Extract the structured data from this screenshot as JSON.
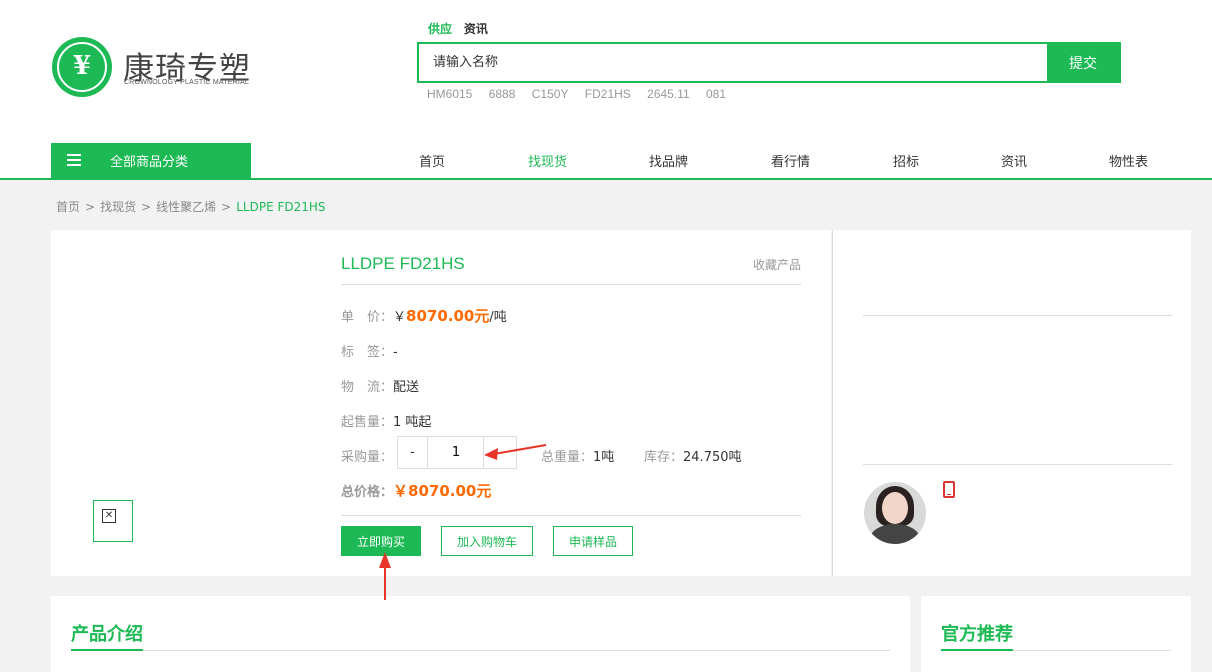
{
  "brand": {
    "name": "康琦专塑",
    "subtitle": "CROWNOLOGY PLASTIC MATERIAL"
  },
  "search": {
    "tabs": [
      "供应",
      "资讯"
    ],
    "placeholder": "请输入名称",
    "submit_label": "提交",
    "hot_keywords": [
      "HM6015",
      "6888",
      "C150Y",
      "FD21HS",
      "2645.11",
      "081"
    ]
  },
  "nav": {
    "category_label": "全部商品分类",
    "items": [
      "首页",
      "找现货",
      "找品牌",
      "看行情",
      "招标",
      "资讯",
      "物性表"
    ],
    "active": "找现货"
  },
  "breadcrumb": [
    "首页",
    "找现货",
    "线性聚乙烯",
    "LLDPE FD21HS"
  ],
  "product": {
    "title": "LLDPE FD21HS",
    "favorite_label": "收藏产品",
    "unit_price_label": "单　价：",
    "unit_price_symbol": "￥",
    "unit_price_value": "8070.00元",
    "unit_price_unit": "/吨",
    "tag_label": "标　签：",
    "tag_value": "-",
    "logistics_label": "物　流：",
    "logistics_value": "配送",
    "min_order_label": "起售量：",
    "min_order_value": "1 吨起",
    "quantity_label": "采购量：",
    "quantity_value": "1",
    "minus": "-",
    "total_weight_label": "总重量：",
    "total_weight_value": "1吨",
    "stock_label": "库存：",
    "stock_value": "24.750吨",
    "total_price_label": "总价格：",
    "total_price_value": "￥8070.00元",
    "buy_now_label": "立即购买",
    "add_cart_label": "加入购物车",
    "sample_label": "申请样品"
  },
  "sections": {
    "intro_title": "产品介绍",
    "recommend_title": "官方推荐"
  },
  "colors": {
    "accent": "#1db954",
    "price": "#ff6a00",
    "annotation_arrow": "#e8352a"
  },
  "icons": [
    "menu-icon",
    "phone-icon",
    "broken-image-icon"
  ]
}
